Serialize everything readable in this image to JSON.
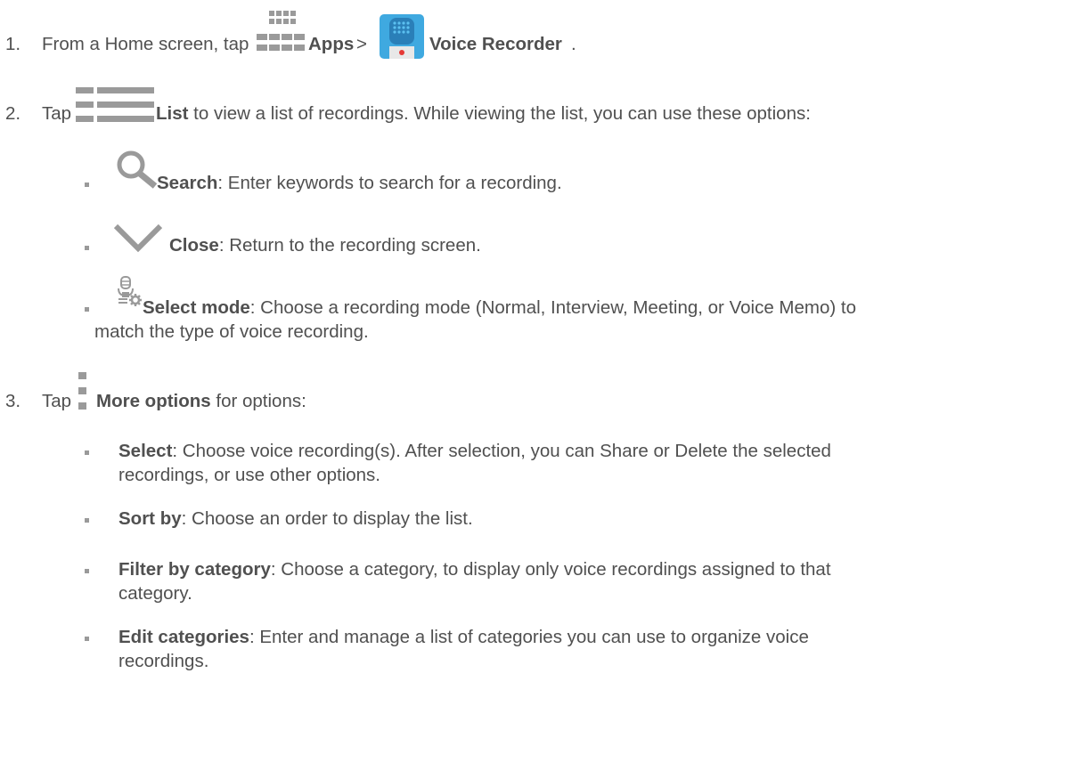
{
  "steps": [
    {
      "number": "1.",
      "text_before": "From a Home screen, tap",
      "apps_label": "Apps",
      "separator": ">",
      "voice_recorder_label": "Voice Recorder",
      "end": "."
    },
    {
      "number": "2.",
      "text_before": "Tap",
      "list_label": "List",
      "text_after": " to view a list of recordings. While viewing the list, you can use these options:",
      "options": [
        {
          "label": "Search",
          "desc": ": Enter keywords to search for a recording."
        },
        {
          "label": "Close",
          "desc": ": Return to the recording screen."
        },
        {
          "label": "Select mode",
          "desc_line1": ": Choose a recording mode (Normal, Interview, Meeting, or Voice Memo) to",
          "desc_line2": "match the type of voice recording."
        }
      ]
    },
    {
      "number": "3.",
      "text_before": "Tap",
      "more_label": "More options",
      "text_after": " for options:",
      "options": [
        {
          "label": "Select",
          "desc_line1": ": Choose voice recording(s). After selection, you can Share or Delete the selected",
          "desc_line2": "recordings, or use other options."
        },
        {
          "label": "Sort by",
          "desc_line1": ": Choose an order to display the list."
        },
        {
          "label": "Filter by category",
          "desc_line1": ": Choose a category, to display only voice recordings assigned to that",
          "desc_line2": "category."
        },
        {
          "label": "Edit categories",
          "desc_line1": ": Enter and manage a list of categories you can use to organize voice",
          "desc_line2": "recordings."
        }
      ]
    }
  ],
  "icons": {
    "apps": "apps-grid-icon",
    "voice_recorder": "voice-recorder-app-icon",
    "list": "list-icon",
    "search": "search-icon",
    "close": "chevron-down-icon",
    "select_mode": "mic-settings-icon",
    "more_options": "more-options-icon"
  },
  "colors": {
    "text": "#505050",
    "icon_gray": "#9a9a9a",
    "recorder_blue": "#3fa9e0"
  }
}
